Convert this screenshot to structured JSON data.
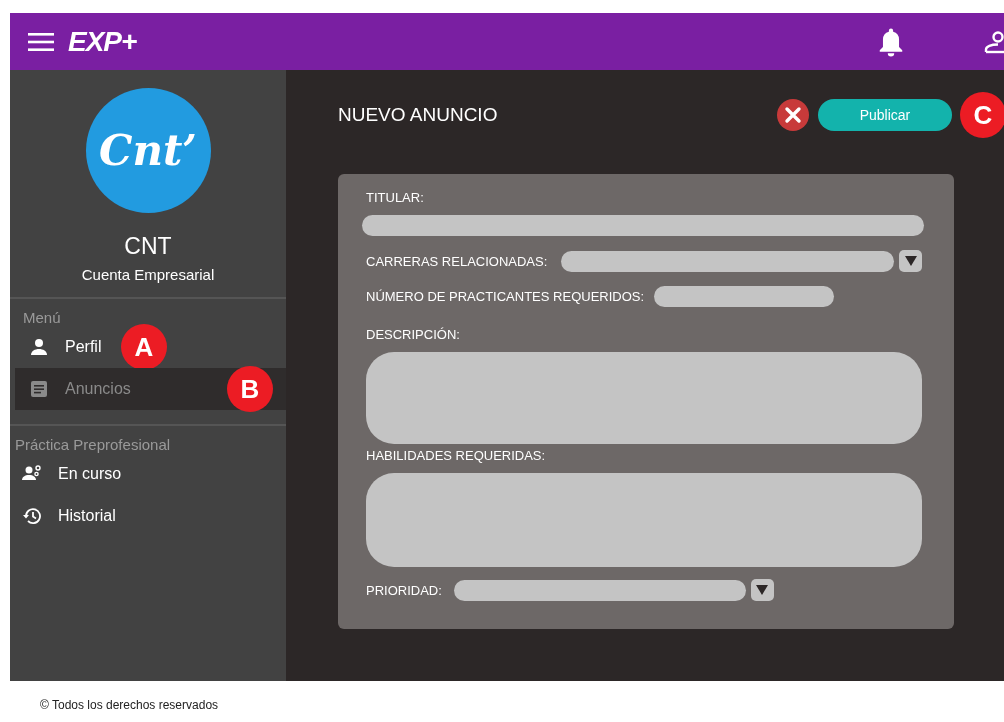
{
  "header": {
    "title": "EXP+"
  },
  "sidebar": {
    "logo": "Cnt’",
    "name": "CNT",
    "subtitle": "Cuenta Empresarial",
    "sections": [
      {
        "title": "Menú",
        "items": [
          {
            "label": "Perfil",
            "selected": false,
            "badge": "A"
          },
          {
            "label": "Anuncios",
            "selected": true,
            "badge": "B"
          }
        ]
      },
      {
        "title": "Práctica Preprofesional",
        "items": [
          {
            "label": "En curso",
            "selected": false
          },
          {
            "label": "Historial",
            "selected": false
          }
        ]
      }
    ]
  },
  "main": {
    "title": "NUEVO ANUNCIO",
    "publish_button": "Publicar",
    "publish_badge": "C",
    "fields": [
      {
        "label": "TITULAR:",
        "kind": "line"
      },
      {
        "label": "CARRERAS RELACIONADAS:",
        "kind": "select"
      },
      {
        "label": "NÚMERO DE PRACTICANTES REQUERIDOS:",
        "kind": "short"
      },
      {
        "label": "DESCRIPCIÓN:",
        "kind": "area"
      },
      {
        "label": "HABILIDADES REQUERIDAS:",
        "kind": "area"
      },
      {
        "label": "PRIORIDAD:",
        "kind": "select"
      }
    ]
  },
  "footer": "© Todos los derechos reservados"
}
